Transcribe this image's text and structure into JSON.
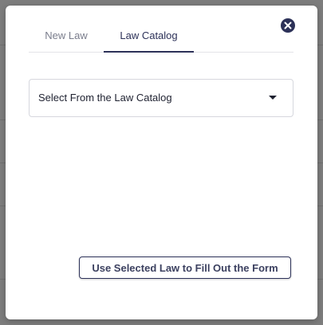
{
  "tabs": [
    {
      "label": "New Law",
      "active": false
    },
    {
      "label": "Law Catalog",
      "active": true
    }
  ],
  "select": {
    "value": "Select From the Law Catalog"
  },
  "actions": {
    "use_selected_label": "Use Selected Law to Fill Out the Form"
  },
  "icons": {
    "close": "close-icon",
    "dropdown": "caret-down-icon"
  },
  "colors": {
    "accent": "#2c3158",
    "inactive_tab": "#7a7d8c",
    "border": "#d6d7de",
    "backdrop": "#7d7d7d"
  }
}
